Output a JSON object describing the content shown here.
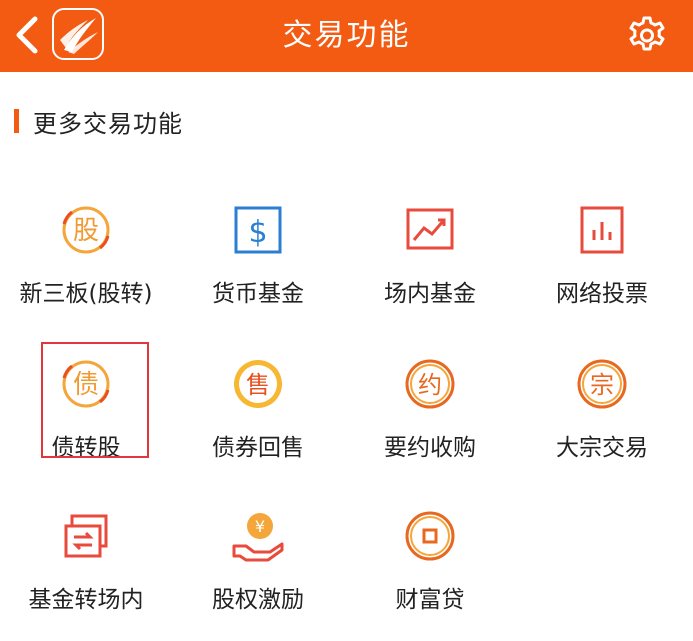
{
  "header": {
    "title": "交易功能",
    "back_icon": "chevron-left-icon",
    "settings_icon": "gear-icon",
    "color": "#f35a12"
  },
  "section": {
    "title": "更多交易功能"
  },
  "items": [
    {
      "label": "新三板(股转)",
      "icon": "share-transfer-icon",
      "glyph": "股"
    },
    {
      "label": "货币基金",
      "icon": "dollar-icon",
      "glyph": "$"
    },
    {
      "label": "场内基金",
      "icon": "trend-chart-icon"
    },
    {
      "label": "网络投票",
      "icon": "bar-chart-icon"
    },
    {
      "label": "债转股",
      "icon": "bond-convert-icon",
      "glyph": "债",
      "selected": true
    },
    {
      "label": "债券回售",
      "icon": "bond-sellback-icon",
      "glyph": "售"
    },
    {
      "label": "要约收购",
      "icon": "tender-offer-icon",
      "glyph": "约"
    },
    {
      "label": "大宗交易",
      "icon": "block-trade-icon",
      "glyph": "宗"
    },
    {
      "label": "基金转场内",
      "icon": "fund-transfer-icon"
    },
    {
      "label": "股权激励",
      "icon": "equity-incentive-icon",
      "glyph": "¥"
    },
    {
      "label": "财富贷",
      "icon": "wealth-loan-icon"
    }
  ]
}
